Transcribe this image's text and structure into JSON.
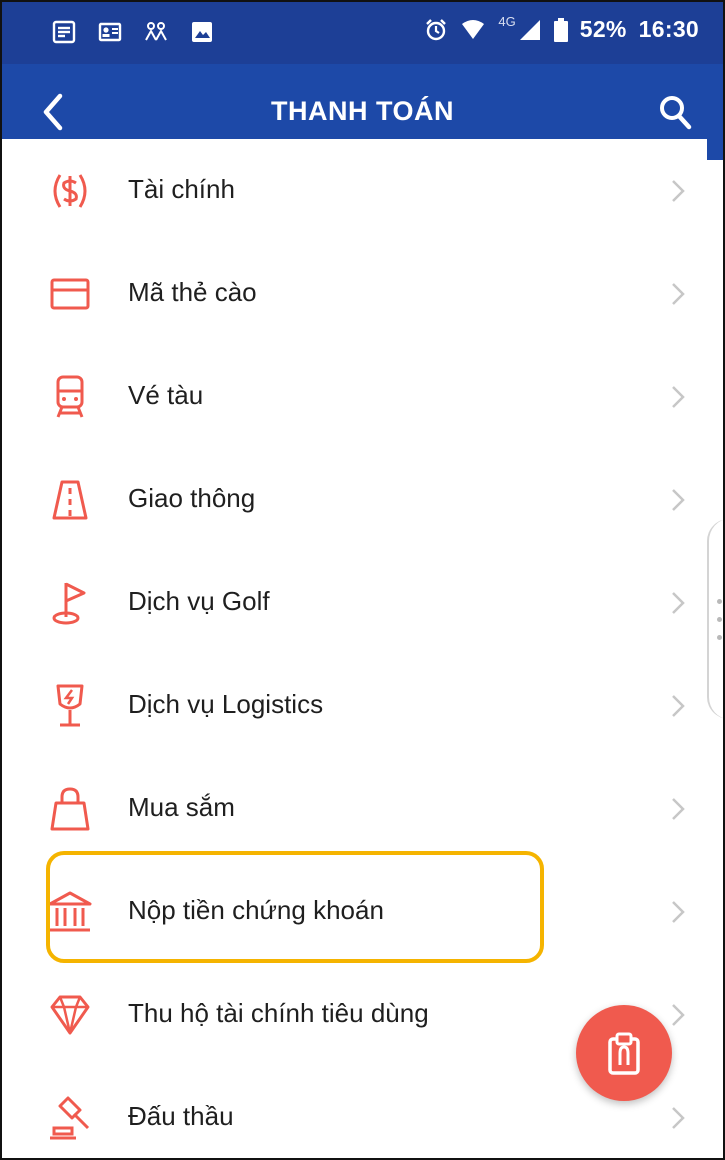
{
  "status_bar": {
    "battery": "52%",
    "time": "16:30",
    "network": "4G",
    "icons": [
      "notes-icon",
      "contact-card-icon",
      "people-icon",
      "image-icon",
      "alarm-icon",
      "wifi-icon",
      "signal-icon",
      "battery-icon"
    ]
  },
  "app_bar": {
    "title": "THANH TOÁN",
    "back_icon": "back-arrow-icon",
    "search_icon": "search-icon"
  },
  "list": {
    "items": [
      {
        "label": "Tài chính",
        "icon": "finance-dollar-icon"
      },
      {
        "label": "Mã thẻ cào",
        "icon": "card-icon"
      },
      {
        "label": "Vé tàu",
        "icon": "train-icon"
      },
      {
        "label": "Giao thông",
        "icon": "road-icon"
      },
      {
        "label": "Dịch vụ Golf",
        "icon": "golf-flag-icon"
      },
      {
        "label": "Dịch vụ Logistics",
        "icon": "logistics-icon"
      },
      {
        "label": "Mua sắm",
        "icon": "shopping-bag-icon"
      },
      {
        "label": "Nộp tiền chứng khoán",
        "icon": "bank-icon",
        "highlighted": true
      },
      {
        "label": "Thu hộ tài chính tiêu dùng",
        "icon": "diamond-icon"
      },
      {
        "label": "Đấu thầu",
        "icon": "auction-gavel-icon"
      }
    ]
  },
  "fab": {
    "icon": "clipboard-icon"
  },
  "colors": {
    "status_bar": "#1d3f96",
    "app_bar": "#1d49a8",
    "accent": "#f05a4e",
    "highlight": "#f5b400",
    "text": "#1f1f1f",
    "chevron": "#c7c7c7"
  }
}
